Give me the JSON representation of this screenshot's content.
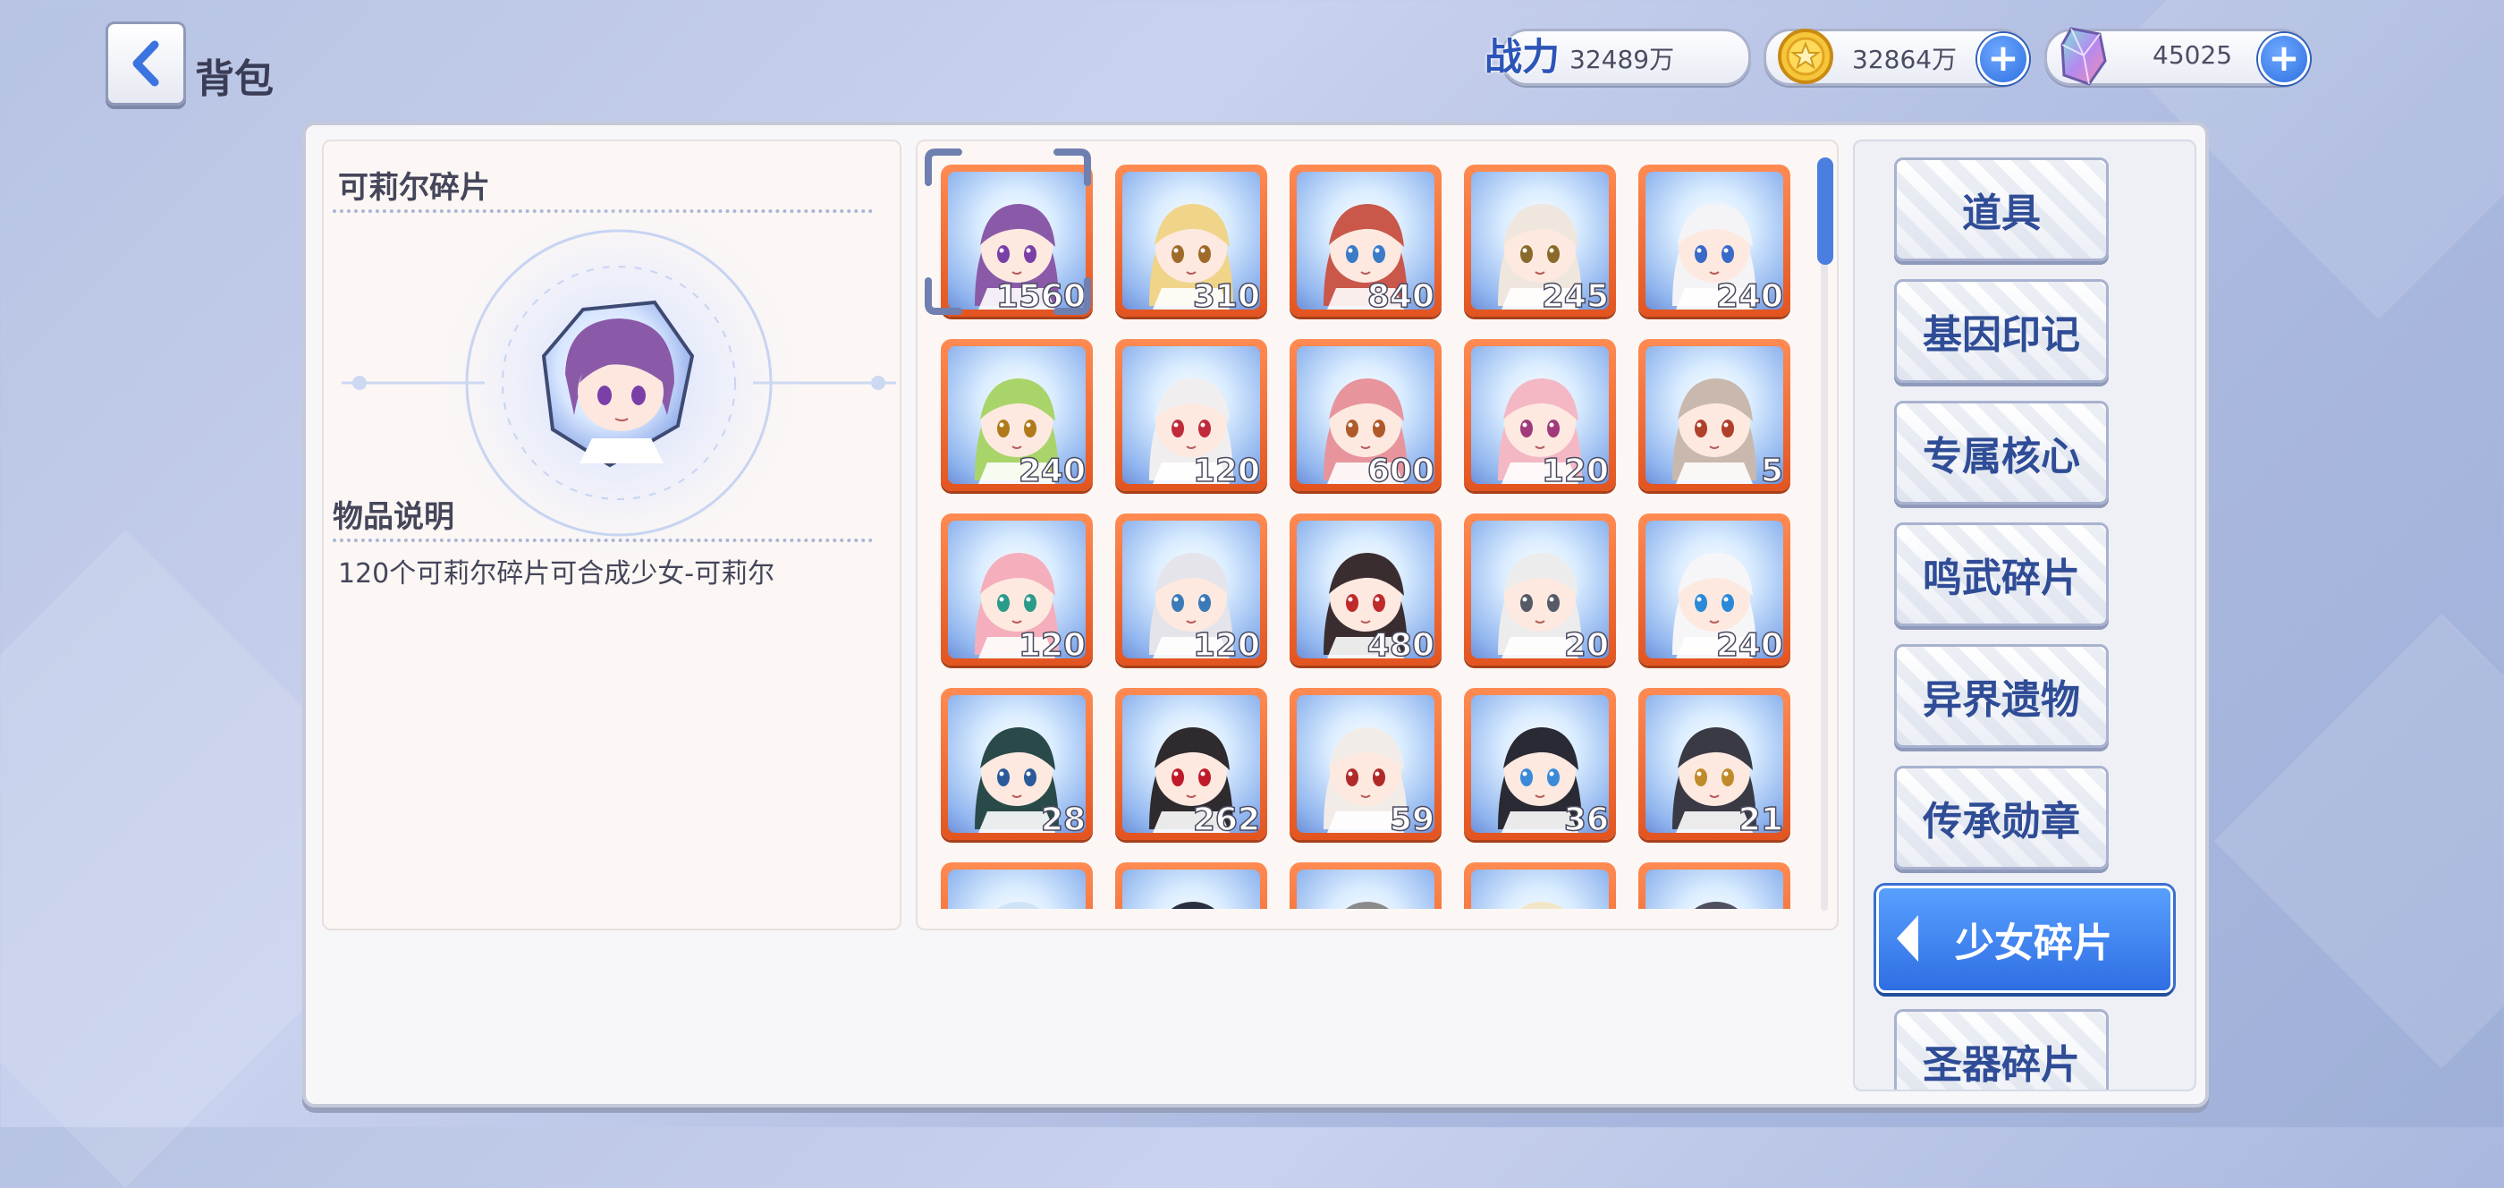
{
  "header": {
    "title": "背包",
    "power_label": "战力",
    "power_value": "32489万",
    "gold_value": "32864万",
    "gem_value": "45025",
    "plus_symbol": "+"
  },
  "detail": {
    "item_name": "可莉尔碎片",
    "desc_label": "物品说明",
    "desc_text": "120个可莉尔碎片可合成少女-可莉尔"
  },
  "grid": {
    "items": [
      {
        "count": "1560",
        "hair": "#8a5aa8",
        "eye": "#7b3fa8"
      },
      {
        "count": "310",
        "hair": "#f0d48a",
        "eye": "#a06a2a"
      },
      {
        "count": "840",
        "hair": "#c9574a",
        "eye": "#3a7bc8"
      },
      {
        "count": "245",
        "hair": "#efe6de",
        "eye": "#8a6a2a"
      },
      {
        "count": "240",
        "hair": "#f4f4f6",
        "eye": "#3a6ac8"
      },
      {
        "count": "240",
        "hair": "#a9d46a",
        "eye": "#b07a1a"
      },
      {
        "count": "120",
        "hair": "#f1eef0",
        "eye": "#c02a3a"
      },
      {
        "count": "600",
        "hair": "#e7949c",
        "eye": "#b05a2a"
      },
      {
        "count": "120",
        "hair": "#f4b8c4",
        "eye": "#a03a7a"
      },
      {
        "count": "5",
        "hair": "#c9b8ad",
        "eye": "#b0402a"
      },
      {
        "count": "120",
        "hair": "#f5aebb",
        "eye": "#2a9a8a"
      },
      {
        "count": "120",
        "hair": "#e4e4ea",
        "eye": "#3a7ab8"
      },
      {
        "count": "480",
        "hair": "#3a2d30",
        "eye": "#c02a2a"
      },
      {
        "count": "20",
        "hair": "#ececec",
        "eye": "#555a66"
      },
      {
        "count": "240",
        "hair": "#f6f6f8",
        "eye": "#2a8ad8"
      },
      {
        "count": "28",
        "hair": "#2a4a4a",
        "eye": "#2a5a9a"
      },
      {
        "count": "262",
        "hair": "#2f2a2e",
        "eye": "#c01a2a"
      },
      {
        "count": "59",
        "hair": "#f2ece8",
        "eye": "#b02a2a"
      },
      {
        "count": "36",
        "hair": "#2a2a34",
        "eye": "#3a8ad8"
      },
      {
        "count": "21",
        "hair": "#3a3a44",
        "eye": "#c08a2a"
      },
      {
        "count": "",
        "hair": "#cfe4f6",
        "eye": "#5a7ab8"
      },
      {
        "count": "",
        "hair": "#2a3040",
        "eye": "#3a5aa8"
      },
      {
        "count": "",
        "hair": "#8a8a8a",
        "eye": "#555555"
      },
      {
        "count": "",
        "hair": "#f2e6c8",
        "eye": "#a07a2a"
      },
      {
        "count": "",
        "hair": "#505060",
        "eye": "#5a5a7a"
      }
    ]
  },
  "menu": {
    "items": [
      {
        "label": "道具"
      },
      {
        "label": "基因印记"
      },
      {
        "label": "专属核心"
      },
      {
        "label": "鸣武碎片"
      },
      {
        "label": "异界遗物"
      },
      {
        "label": "传承勋章"
      },
      {
        "label": "少女碎片",
        "active": true
      },
      {
        "label": "圣器碎片"
      }
    ]
  },
  "colors": {
    "accent": "#2f6ee3",
    "tile_border": "#e25420",
    "menu_text": "#2f4c96"
  },
  "icons": [
    "chevron-left-icon",
    "power-icon",
    "gold-coin-icon",
    "crystal-gem-icon",
    "plus-icon",
    "selection-frame-icon"
  ]
}
